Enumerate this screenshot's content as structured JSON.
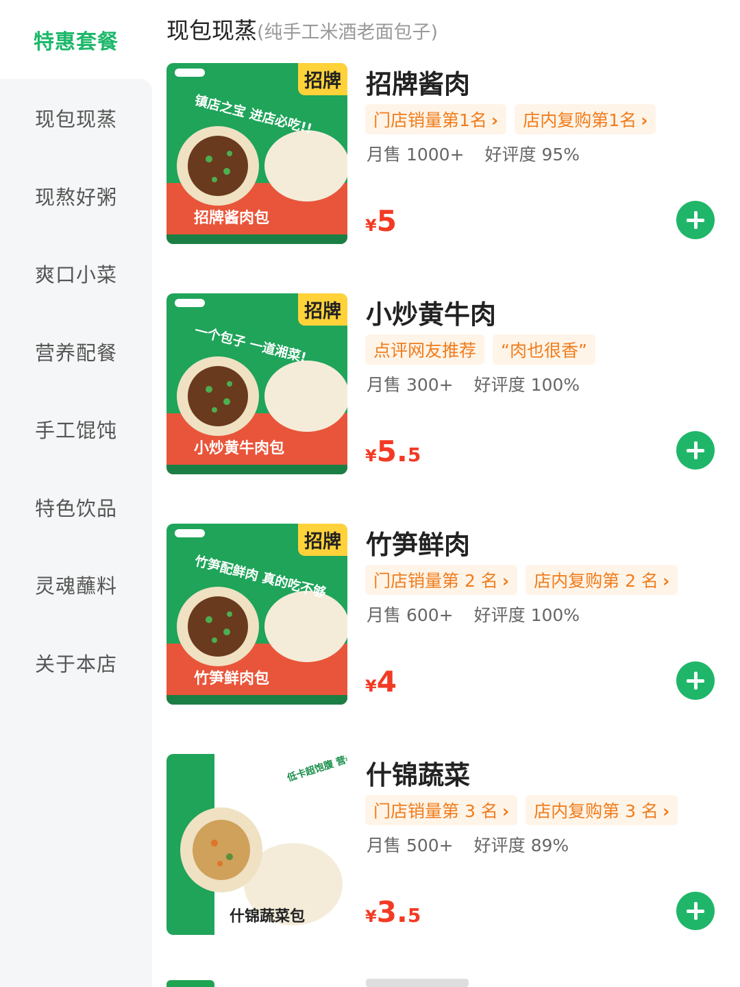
{
  "sidebar": {
    "active": "特惠套餐",
    "items": [
      "现包现蒸",
      "现熬好粥",
      "爽口小菜",
      "营养配餐",
      "手工馄饨",
      "特色饮品",
      "灵魂蘸料",
      "关于本店"
    ]
  },
  "section": {
    "title": "现包现蒸",
    "subtitle": "(纯手工米酒老面包子)"
  },
  "colors": {
    "accent_green": "#1db86a",
    "price_red": "#f23b24",
    "tag_orange": "#f07c1c",
    "tag_bg": "#fff4e8",
    "badge_yellow": "#ffd23a"
  },
  "products": [
    {
      "name": "招牌酱肉",
      "badge": "招牌",
      "image_slogan": "镇店之宝 进店必吃!!",
      "image_caption": "招牌酱肉包",
      "tags": [
        {
          "text": "门店销量第1名",
          "chevron": "›"
        },
        {
          "text": "店内复购第1名",
          "chevron": "›"
        }
      ],
      "monthly_sales": "月售 1000+",
      "rating": "好评度 95%",
      "price_symbol": "¥",
      "price_int": "5",
      "price_dec": ""
    },
    {
      "name": "小炒黄牛肉",
      "badge": "招牌",
      "image_slogan": "一个包子 一道湘菜!",
      "image_caption": "小炒黄牛肉包",
      "tags": [
        {
          "text": "点评网友推荐",
          "chevron": ""
        },
        {
          "text": "“肉也很香”",
          "chevron": ""
        }
      ],
      "monthly_sales": "月售 300+",
      "rating": "好评度 100%",
      "price_symbol": "¥",
      "price_int": "5.",
      "price_dec": "5"
    },
    {
      "name": "竹笋鲜肉",
      "badge": "招牌",
      "image_slogan": "竹笋配鲜肉 真的吃不够",
      "image_caption": "竹笋鲜肉包",
      "tags": [
        {
          "text": "门店销量第 2 名",
          "chevron": "›"
        },
        {
          "text": "店内复购第 2 名",
          "chevron": "›"
        }
      ],
      "monthly_sales": "月售 600+",
      "rating": "好评度 100%",
      "price_symbol": "¥",
      "price_int": "4",
      "price_dec": ""
    },
    {
      "name": "什锦蔬菜",
      "badge": "",
      "image_slogan": "低卡超饱腹 营养又健康",
      "image_caption": "什锦蔬菜包",
      "tags": [
        {
          "text": "门店销量第 3 名",
          "chevron": "›"
        },
        {
          "text": "店内复购第 3 名",
          "chevron": "›"
        }
      ],
      "monthly_sales": "月售 500+",
      "rating": "好评度 89%",
      "price_symbol": "¥",
      "price_int": "3.",
      "price_dec": "5"
    }
  ]
}
